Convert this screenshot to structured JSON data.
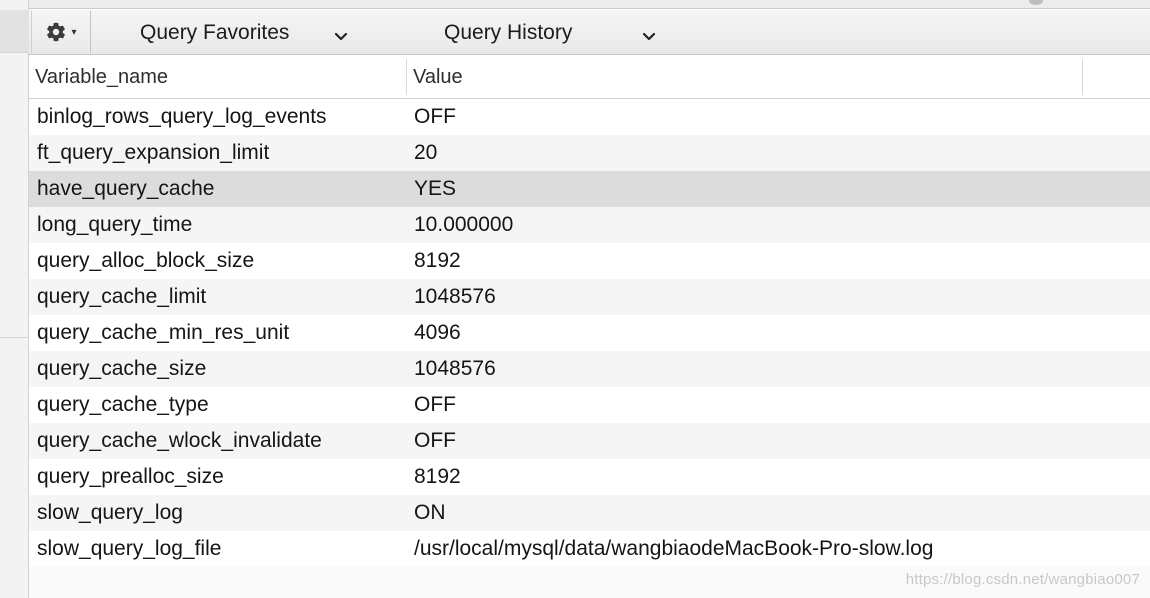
{
  "toolbar": {
    "gear_icon": "gear-icon",
    "gear_caret": "▾",
    "favorites_label": "Query Favorites",
    "history_label": "Query History"
  },
  "table": {
    "columns": [
      "Variable_name",
      "Value"
    ],
    "selected_row_index": 2,
    "rows": [
      {
        "name": "binlog_rows_query_log_events",
        "value": "OFF"
      },
      {
        "name": "ft_query_expansion_limit",
        "value": "20"
      },
      {
        "name": "have_query_cache",
        "value": "YES"
      },
      {
        "name": "long_query_time",
        "value": "10.000000"
      },
      {
        "name": "query_alloc_block_size",
        "value": "8192"
      },
      {
        "name": "query_cache_limit",
        "value": "1048576"
      },
      {
        "name": "query_cache_min_res_unit",
        "value": "4096"
      },
      {
        "name": "query_cache_size",
        "value": "1048576"
      },
      {
        "name": "query_cache_type",
        "value": "OFF"
      },
      {
        "name": "query_cache_wlock_invalidate",
        "value": "OFF"
      },
      {
        "name": "query_prealloc_size",
        "value": "8192"
      },
      {
        "name": "slow_query_log",
        "value": "ON"
      },
      {
        "name": "slow_query_log_file",
        "value": "/usr/local/mysql/data/wangbiaodeMacBook-Pro-slow.log"
      }
    ]
  },
  "watermark": "https://blog.csdn.net/wangbiao007",
  "colors": {
    "selected_row": "#dcdcdc",
    "striped_row": "#f5f5f5",
    "toolbar_bg": "#eeeeee"
  }
}
